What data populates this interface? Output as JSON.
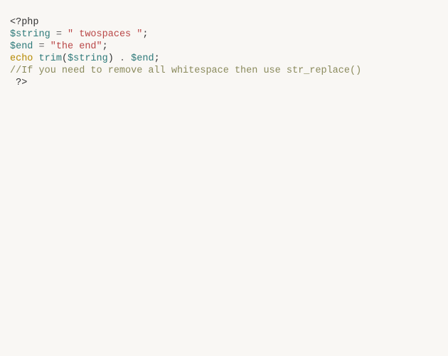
{
  "code": {
    "line1": {
      "open_tag": "<?php"
    },
    "line2": {
      "var": "$string",
      "eq": " = ",
      "str": "\" twospaces \"",
      "semi": ";"
    },
    "line3": {
      "var": "$end",
      "eq": " = ",
      "str": "\"the end\"",
      "semi": ";"
    },
    "line4": {
      "echo": "echo",
      "sp1": " ",
      "func": "trim",
      "lp": "(",
      "arg": "$string",
      "rp": ")",
      "concat": " . ",
      "var2": "$end",
      "semi": ";"
    },
    "line5": {
      "comment": "//If you need to remove all whitespace then use str_replace()"
    },
    "line6": {
      "sp": " ",
      "close_tag": "?>"
    }
  }
}
